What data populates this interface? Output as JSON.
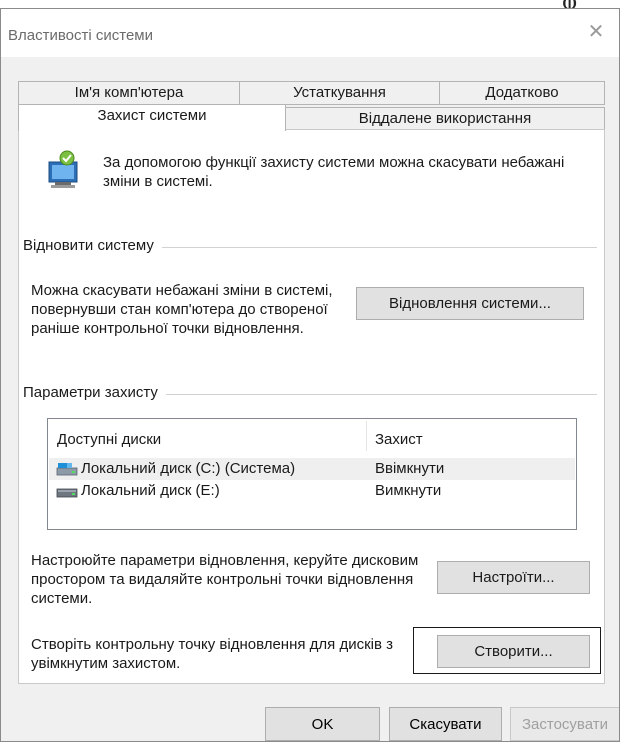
{
  "top_glyph": "ɸ",
  "window": {
    "title": "Властивості системи",
    "close_glyph": "✕"
  },
  "tabs": {
    "computer_name": "Ім'я комп'ютера",
    "hardware": "Устаткування",
    "advanced": "Додатково",
    "system_protection": "Захист системи",
    "remote": "Віддалене використання"
  },
  "intro": {
    "text": "За допомогою функції захисту системи можна скасувати небажані зміни в системі."
  },
  "restore": {
    "group_title": "Відновити систему",
    "description": "Можна скасувати небажані зміни в системі, повернувши стан комп'ютера до створеної раніше контрольної точки відновлення.",
    "button": "Відновлення системи..."
  },
  "protection": {
    "group_title": "Параметри захисту",
    "columns": [
      "Доступні диски",
      "Захист"
    ],
    "rows": [
      {
        "drive": "Локальний диск (C:) (Система)",
        "status": "Ввімкнути"
      },
      {
        "drive": "Локальний диск (E:)",
        "status": "Вимкнути"
      }
    ],
    "configure_text": "Настроюйте параметри відновлення, керуйте дисковим простором та видаляйте контрольні точки відновлення системи.",
    "configure_button": "Настроїти...",
    "create_text": "Створіть контрольну точку відновлення для дисків з увімкнутим захистом.",
    "create_button": "Створити..."
  },
  "footer": {
    "ok": "OK",
    "cancel": "Скасувати",
    "apply": "Застосувати"
  }
}
